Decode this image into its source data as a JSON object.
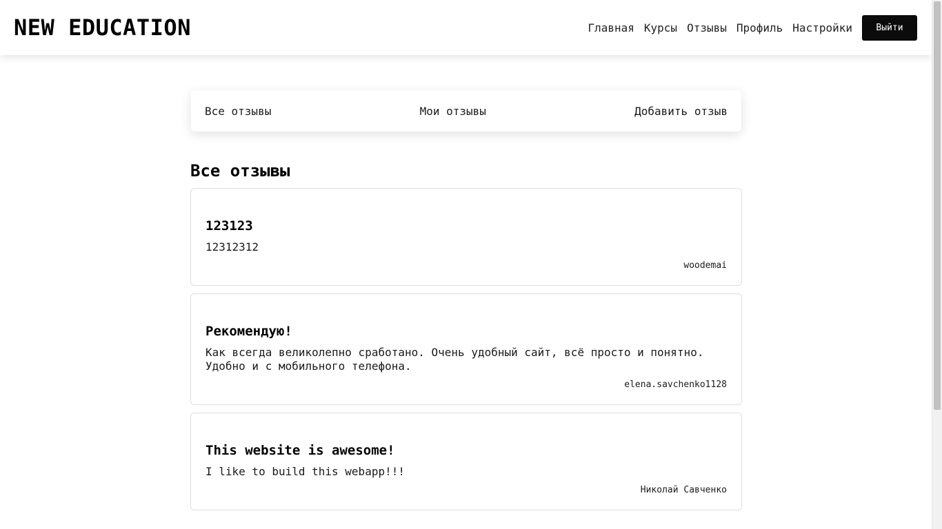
{
  "header": {
    "logo": "NEW EDUCATION",
    "nav": [
      {
        "label": "Главная"
      },
      {
        "label": "Курсы"
      },
      {
        "label": "Отзывы"
      },
      {
        "label": "Профиль"
      },
      {
        "label": "Настройки"
      }
    ],
    "logout_label": "Выйти"
  },
  "tabs": [
    {
      "label": "Все отзывы"
    },
    {
      "label": "Мои отзывы"
    },
    {
      "label": "Добавить отзыв"
    }
  ],
  "section_title": "Все отзывы",
  "reviews": [
    {
      "title": "123123",
      "text": "12312312",
      "author": "woodemai"
    },
    {
      "title": "Рекомендую!",
      "text": "Как всегда великолепно сработано. Очень удобный сайт, всё просто и понятно. Удобно и с мобильного телефона.",
      "author": "elena.savchenko1128"
    },
    {
      "title": "This website is awesome!",
      "text": "I like to build this webapp!!!",
      "author": "Николай Савченко"
    }
  ],
  "colors": {
    "accent": "#0b0b0b",
    "card_border": "#dedede",
    "background": "#ffffff"
  }
}
